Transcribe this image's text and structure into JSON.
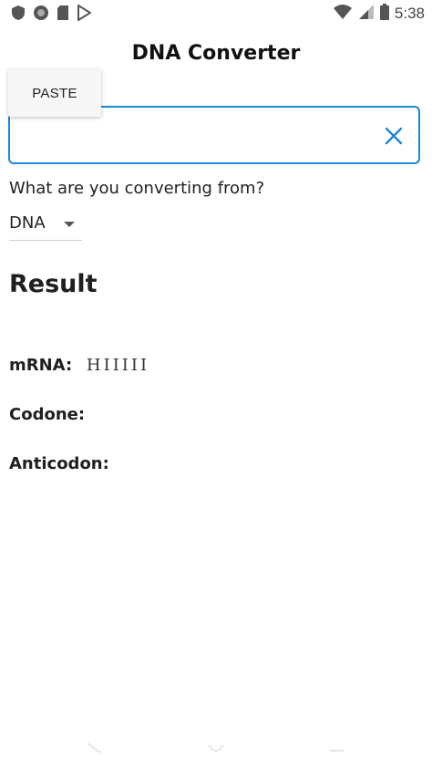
{
  "status_bar": {
    "time": "5:38",
    "left_icons": [
      "shield-icon",
      "circle-record-icon",
      "sd-card-icon",
      "play-store-icon"
    ],
    "right_icons": [
      "wifi-icon",
      "cell-signal-icon",
      "battery-icon"
    ]
  },
  "app": {
    "title": "DNA Converter"
  },
  "context_menu": {
    "paste_label": "PASTE"
  },
  "input": {
    "value": "",
    "placeholder": "",
    "accent_color": "#1f88d6"
  },
  "form": {
    "question": "What are you converting from?",
    "selected_type": "DNA"
  },
  "result": {
    "heading": "Result",
    "rows": [
      {
        "label": "mRNA:",
        "value": "HIIIII"
      },
      {
        "label": "Codone:",
        "value": ""
      },
      {
        "label": "Anticodon:",
        "value": ""
      }
    ]
  }
}
